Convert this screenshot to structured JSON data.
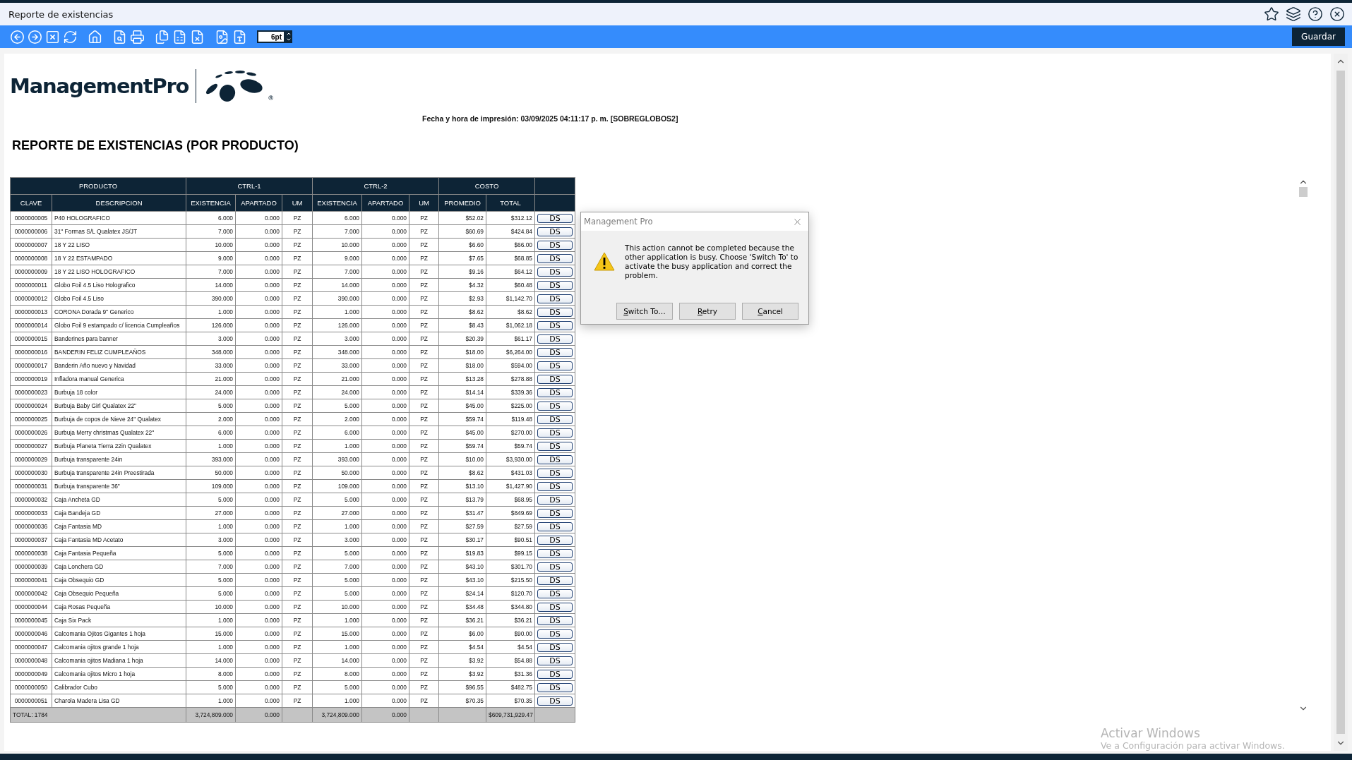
{
  "window": {
    "title": "Reporte de existencias"
  },
  "toolbar": {
    "font_size": "6pt",
    "save_button": "Guardar"
  },
  "report": {
    "logo": {
      "text": "ManagementPro",
      "mark": "®"
    },
    "printed_at": "Fecha y hora de impresión: 03/09/2025 04:11:17 p. m. [SOBREGLOBOS2]",
    "heading": "REPORTE DE EXISTENCIAS (POR PRODUCTO)",
    "table": {
      "groups": [
        {
          "label": "PRODUCTO",
          "columns": [
            "CLAVE",
            "DESCRIPCION"
          ]
        },
        {
          "label": "CTRL-1",
          "columns": [
            "EXISTENCIA",
            "APARTADO",
            "UM"
          ]
        },
        {
          "label": "CTRL-2",
          "columns": [
            "EXISTENCIA",
            "APARTADO",
            "UM"
          ]
        },
        {
          "label": "COSTO",
          "columns": [
            "PROMEDIO",
            "TOTAL"
          ]
        }
      ],
      "rows": [
        {
          "cells": [
            "0000000005",
            "P40 HOLOGRAFICO",
            "6.000",
            "0.000",
            "PZ",
            "6.000",
            "0.000",
            "PZ",
            "$52.02",
            "$312.12"
          ],
          "action": "DS"
        },
        {
          "cells": [
            "0000000006",
            "31\" Formas S/L Qualatex JS/JT",
            "7.000",
            "0.000",
            "PZ",
            "7.000",
            "0.000",
            "PZ",
            "$60.69",
            "$424.84"
          ],
          "action": "DS"
        },
        {
          "cells": [
            "0000000007",
            "18 Y 22 LISO",
            "10.000",
            "0.000",
            "PZ",
            "10.000",
            "0.000",
            "PZ",
            "$6.60",
            "$66.00"
          ],
          "action": "DS"
        },
        {
          "cells": [
            "0000000008",
            "18 Y 22 ESTAMPADO",
            "9.000",
            "0.000",
            "PZ",
            "9.000",
            "0.000",
            "PZ",
            "$7.65",
            "$68.85"
          ],
          "action": "DS"
        },
        {
          "cells": [
            "0000000009",
            "18 Y 22 LISO HOLOGRAFICO",
            "7.000",
            "0.000",
            "PZ",
            "7.000",
            "0.000",
            "PZ",
            "$9.16",
            "$64.12"
          ],
          "action": "DS"
        },
        {
          "cells": [
            "0000000011",
            "Globo Foil 4.5 Liso Holografico",
            "14.000",
            "0.000",
            "PZ",
            "14.000",
            "0.000",
            "PZ",
            "$4.32",
            "$60.48"
          ],
          "action": "DS"
        },
        {
          "cells": [
            "0000000012",
            "Globo Foil 4.5 Liso",
            "390.000",
            "0.000",
            "PZ",
            "390.000",
            "0.000",
            "PZ",
            "$2.93",
            "$1,142.70"
          ],
          "action": "DS"
        },
        {
          "cells": [
            "0000000013",
            "CORONA Dorada 9\" Generico",
            "1.000",
            "0.000",
            "PZ",
            "1.000",
            "0.000",
            "PZ",
            "$8.62",
            "$8.62"
          ],
          "action": "DS"
        },
        {
          "cells": [
            "0000000014",
            "Globo Foil 9 estampado c/ licencia Cumpleaños",
            "126.000",
            "0.000",
            "PZ",
            "126.000",
            "0.000",
            "PZ",
            "$8.43",
            "$1,062.18"
          ],
          "action": "DS"
        },
        {
          "cells": [
            "0000000015",
            "Banderines para banner",
            "3.000",
            "0.000",
            "PZ",
            "3.000",
            "0.000",
            "PZ",
            "$20.39",
            "$61.17"
          ],
          "action": "DS"
        },
        {
          "cells": [
            "0000000016",
            "BANDERIN FELIZ CUMPLEAÑOS",
            "348.000",
            "0.000",
            "PZ",
            "348.000",
            "0.000",
            "PZ",
            "$18.00",
            "$6,264.00"
          ],
          "action": "DS"
        },
        {
          "cells": [
            "0000000017",
            "Banderin Año nuevo y Navidad",
            "33.000",
            "0.000",
            "PZ",
            "33.000",
            "0.000",
            "PZ",
            "$18.00",
            "$594.00"
          ],
          "action": "DS"
        },
        {
          "cells": [
            "0000000019",
            "Infladora manual Generica",
            "21.000",
            "0.000",
            "PZ",
            "21.000",
            "0.000",
            "PZ",
            "$13.28",
            "$278.88"
          ],
          "action": "DS"
        },
        {
          "cells": [
            "0000000023",
            "Burbuja 18 color",
            "24.000",
            "0.000",
            "PZ",
            "24.000",
            "0.000",
            "PZ",
            "$14.14",
            "$339.36"
          ],
          "action": "DS"
        },
        {
          "cells": [
            "0000000024",
            "Burbuja Baby Girl Qualatex 22\"",
            "5.000",
            "0.000",
            "PZ",
            "5.000",
            "0.000",
            "PZ",
            "$45.00",
            "$225.00"
          ],
          "action": "DS"
        },
        {
          "cells": [
            "0000000025",
            "Burbuja de copos de Nieve 24\" Qualatex",
            "2.000",
            "0.000",
            "PZ",
            "2.000",
            "0.000",
            "PZ",
            "$59.74",
            "$119.48"
          ],
          "action": "DS"
        },
        {
          "cells": [
            "0000000026",
            "Burbuja Merry christmas Qualatex 22\"",
            "6.000",
            "0.000",
            "PZ",
            "6.000",
            "0.000",
            "PZ",
            "$45.00",
            "$270.00"
          ],
          "action": "DS"
        },
        {
          "cells": [
            "0000000027",
            "Burbuja Planeta Tierra 22in Qualatex",
            "1.000",
            "0.000",
            "PZ",
            "1.000",
            "0.000",
            "PZ",
            "$59.74",
            "$59.74"
          ],
          "action": "DS"
        },
        {
          "cells": [
            "0000000029",
            "Burbuja transparente 24in",
            "393.000",
            "0.000",
            "PZ",
            "393.000",
            "0.000",
            "PZ",
            "$10.00",
            "$3,930.00"
          ],
          "action": "DS"
        },
        {
          "cells": [
            "0000000030",
            "Burbuja transparente 24in Preestirada",
            "50.000",
            "0.000",
            "PZ",
            "50.000",
            "0.000",
            "PZ",
            "$8.62",
            "$431.03"
          ],
          "action": "DS"
        },
        {
          "cells": [
            "0000000031",
            "Burbuja transparente 36\"",
            "109.000",
            "0.000",
            "PZ",
            "109.000",
            "0.000",
            "PZ",
            "$13.10",
            "$1,427.90"
          ],
          "action": "DS"
        },
        {
          "cells": [
            "0000000032",
            "Caja Ancheta GD",
            "5.000",
            "0.000",
            "PZ",
            "5.000",
            "0.000",
            "PZ",
            "$13.79",
            "$68.95"
          ],
          "action": "DS"
        },
        {
          "cells": [
            "0000000033",
            "Caja Bandeja GD",
            "27.000",
            "0.000",
            "PZ",
            "27.000",
            "0.000",
            "PZ",
            "$31.47",
            "$849.69"
          ],
          "action": "DS"
        },
        {
          "cells": [
            "0000000036",
            "Caja Fantasia MD",
            "1.000",
            "0.000",
            "PZ",
            "1.000",
            "0.000",
            "PZ",
            "$27.59",
            "$27.59"
          ],
          "action": "DS"
        },
        {
          "cells": [
            "0000000037",
            "Caja Fantasia MD Acetato",
            "3.000",
            "0.000",
            "PZ",
            "3.000",
            "0.000",
            "PZ",
            "$30.17",
            "$90.51"
          ],
          "action": "DS"
        },
        {
          "cells": [
            "0000000038",
            "Caja Fantasia Pequeña",
            "5.000",
            "0.000",
            "PZ",
            "5.000",
            "0.000",
            "PZ",
            "$19.83",
            "$99.15"
          ],
          "action": "DS"
        },
        {
          "cells": [
            "0000000039",
            "Caja Lonchera GD",
            "7.000",
            "0.000",
            "PZ",
            "7.000",
            "0.000",
            "PZ",
            "$43.10",
            "$301.70"
          ],
          "action": "DS"
        },
        {
          "cells": [
            "0000000041",
            "Caja Obsequio GD",
            "5.000",
            "0.000",
            "PZ",
            "5.000",
            "0.000",
            "PZ",
            "$43.10",
            "$215.50"
          ],
          "action": "DS"
        },
        {
          "cells": [
            "0000000042",
            "Caja Obsequio Pequeña",
            "5.000",
            "0.000",
            "PZ",
            "5.000",
            "0.000",
            "PZ",
            "$24.14",
            "$120.70"
          ],
          "action": "DS"
        },
        {
          "cells": [
            "0000000044",
            "Caja Rosas Pequeña",
            "10.000",
            "0.000",
            "PZ",
            "10.000",
            "0.000",
            "PZ",
            "$34.48",
            "$344.80"
          ],
          "action": "DS"
        },
        {
          "cells": [
            "0000000045",
            "Caja Six Pack",
            "1.000",
            "0.000",
            "PZ",
            "1.000",
            "0.000",
            "PZ",
            "$36.21",
            "$36.21"
          ],
          "action": "DS"
        },
        {
          "cells": [
            "0000000046",
            "Calcomania Ojitos Gigantes 1 hoja",
            "15.000",
            "0.000",
            "PZ",
            "15.000",
            "0.000",
            "PZ",
            "$6.00",
            "$90.00"
          ],
          "action": "DS"
        },
        {
          "cells": [
            "0000000047",
            "Calcomania ojitos grande 1 hoja",
            "1.000",
            "0.000",
            "PZ",
            "1.000",
            "0.000",
            "PZ",
            "$4.54",
            "$4.54"
          ],
          "action": "DS"
        },
        {
          "cells": [
            "0000000048",
            "Calcomania ojitos Madiana 1 hoja",
            "14.000",
            "0.000",
            "PZ",
            "14.000",
            "0.000",
            "PZ",
            "$3.92",
            "$54.88"
          ],
          "action": "DS"
        },
        {
          "cells": [
            "0000000049",
            "Calcomania ojitos Micro 1 hoja",
            "8.000",
            "0.000",
            "PZ",
            "8.000",
            "0.000",
            "PZ",
            "$3.92",
            "$31.36"
          ],
          "action": "DS"
        },
        {
          "cells": [
            "0000000050",
            "Calibrador Cubo",
            "5.000",
            "0.000",
            "PZ",
            "5.000",
            "0.000",
            "PZ",
            "$96.55",
            "$482.75"
          ],
          "action": "DS"
        },
        {
          "cells": [
            "0000000051",
            "Charola Madera Lisa GD",
            "1.000",
            "0.000",
            "PZ",
            "1.000",
            "0.000",
            "PZ",
            "$70.35",
            "$70.35"
          ],
          "action": "DS"
        }
      ],
      "total": {
        "label": "TOTAL: 1784",
        "existencia_1": "3,724,809.000",
        "apartado_1": "0.000",
        "existencia_2": "3,724,809.000",
        "apartado_2": "0.000",
        "total": "$609,731,929.47"
      }
    }
  },
  "dialog": {
    "title": "Management Pro",
    "message": "This action cannot be completed because the other application is busy. Choose 'Switch To' to activate the busy application and correct the problem.",
    "buttons": [
      "Switch To…",
      "Retry",
      "Cancel"
    ]
  },
  "os_notice": {
    "title": "Activar Windows",
    "subtitle": "Ve a Configuración para activar Windows."
  }
}
